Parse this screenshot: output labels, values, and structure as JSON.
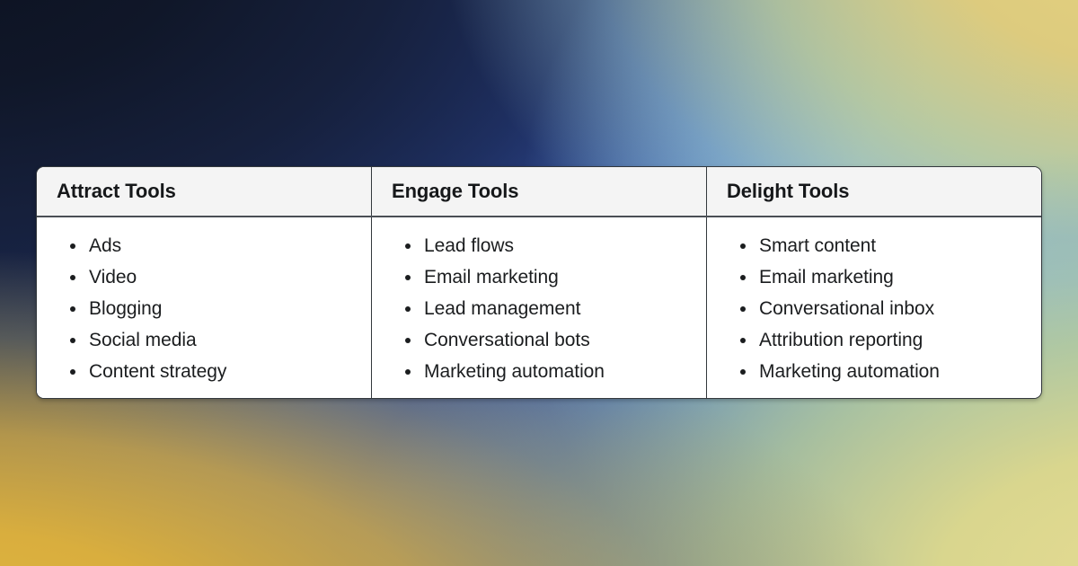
{
  "background": {
    "type": "mesh-gradient",
    "colors": {
      "top_left": "#0d1322",
      "top_center": "#22336e",
      "top_right": "#e3cf7f",
      "center_right": "#9ec9e0",
      "bottom_left": "#dcb345",
      "bottom_center": "#3355ad",
      "bottom_right": "#dfd88e"
    }
  },
  "table": {
    "accent_border": "#33383d",
    "header_background": "#f4f4f4",
    "body_background": "#ffffff",
    "columns": [
      {
        "header": "Attract Tools",
        "items": [
          "Ads",
          "Video",
          "Blogging",
          "Social media",
          "Content strategy"
        ]
      },
      {
        "header": "Engage Tools",
        "items": [
          "Lead flows",
          "Email marketing",
          "Lead management",
          "Conversational bots",
          "Marketing automation"
        ]
      },
      {
        "header": "Delight Tools",
        "items": [
          "Smart content",
          "Email marketing",
          "Conversational inbox",
          "Attribution reporting",
          "Marketing automation"
        ]
      }
    ]
  }
}
